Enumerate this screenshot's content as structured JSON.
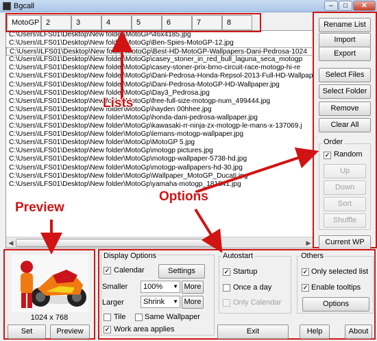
{
  "window": {
    "title": "Bgcall",
    "close_glyph": "✕",
    "min_glyph": "–",
    "max_glyph": "□"
  },
  "tabs": [
    {
      "label": "MotoGP"
    },
    {
      "label": "2"
    },
    {
      "label": "3"
    },
    {
      "label": "4"
    },
    {
      "label": "5"
    },
    {
      "label": "6"
    },
    {
      "label": "7"
    },
    {
      "label": "8"
    }
  ],
  "files": [
    "C:\\Users\\ILFS01\\Desktop\\New folder\\MotoGP\\46x4185.jpg",
    "C:\\Users\\ILFS01\\Desktop\\New folder\\MotoGp\\Ben-Spies-MotoGP-12.jpg",
    "C:\\Users\\ILFS01\\Desktop\\New folder\\MotoGp\\Best-HD-MotoGP-Wallpapers-Dani-Pedrosa-1024",
    "C:\\Users\\ILFS01\\Desktop\\New folder\\MotoGp\\casey_stoner_in_red_bull_laguna_seca_motogp",
    "C:\\Users\\ILFS01\\Desktop\\New folder\\MotoGp\\casey-stoner-prix-brno-circuit-race-motogp-hi-re",
    "C:\\Users\\ILFS01\\Desktop\\New folder\\MotoGp\\Dani-Pedrosa-Honda-Repsol-2013-Full-HD-Wallpap",
    "C:\\Users\\ILFS01\\Desktop\\New folder\\MotoGp\\Dani-Pedrosa-MotoGP-HD-Wallpaper.jpg",
    "C:\\Users\\ILFS01\\Desktop\\New folder\\MotoGp\\Day3_Pedrosa.jpg",
    "C:\\Users\\ILFS01\\Desktop\\New folder\\MotoGp\\free-full-size-motogp-num_499444.jpg",
    "C:\\Users\\ILFS01\\Desktop\\New folder\\MotoGp\\hayden 00hhee.jpg",
    "C:\\Users\\ILFS01\\Desktop\\New folder\\MotoGp\\honda-dani-pedrosa-wallpaper.jpg",
    "C:\\Users\\ILFS01\\Desktop\\New folder\\MotoGp\\kawasaki-rr-ninja-zx-motogp-le-mans-x-137069.j",
    "C:\\Users\\ILFS01\\Desktop\\New folder\\MotoGp\\lemans-motogp-wallpaper.jpg",
    "C:\\Users\\ILFS01\\Desktop\\New folder\\MotoGp\\MotoGP 5.jpg",
    "C:\\Users\\ILFS01\\Desktop\\New folder\\MotoGp\\motogp pictures.jpg",
    "C:\\Users\\ILFS01\\Desktop\\New folder\\MotoGp\\motogp-wallpaper-5738-hd.jpg",
    "C:\\Users\\ILFS01\\Desktop\\New folder\\MotoGp\\motogp-wallpapers-hd-30.jpg",
    "C:\\Users\\ILFS01\\Desktop\\New folder\\MotoGp\\Wallpaper_MotoGP_Ducati.jpg",
    "C:\\Users\\ILFS01\\Desktop\\New folder\\MotoGp\\yamaha-motogp_181841.jpg"
  ],
  "side_buttons": {
    "rename_list": "Rename List",
    "import": "Import",
    "export": "Export",
    "select_files": "Select Files",
    "select_folder": "Select Folder",
    "remove": "Remove",
    "clear_all": "Clear All",
    "order_label": "Order",
    "random": "Random",
    "up": "Up",
    "down": "Down",
    "sort": "Sort",
    "shuffle": "Shuffle",
    "current_wp": "Current WP"
  },
  "preview": {
    "resolution": "1024 x 768",
    "set": "Set",
    "preview": "Preview"
  },
  "display_options": {
    "heading": "Display Options",
    "calendar": "Calendar",
    "settings": "Settings",
    "smaller": "Smaller",
    "smaller_value": "100%",
    "larger": "Larger",
    "larger_value": "Shrink",
    "more": "More",
    "tile": "Tile",
    "same_wallpaper": "Same Wallpaper",
    "work_area": "Work area applies"
  },
  "autostart": {
    "heading": "Autostart",
    "startup": "Startup",
    "once_a_day": "Once a day",
    "only_calendar": "Only Calendar"
  },
  "others": {
    "heading": "Others",
    "only_selected": "Only selected list",
    "tooltips": "Enable tooltips",
    "options": "Options"
  },
  "footer": {
    "exit": "Exit",
    "help": "Help",
    "about": "About"
  },
  "annotations": {
    "lists": "Lists",
    "options": "Options",
    "preview": "Preview"
  },
  "colors": {
    "annotation": "#d01414"
  }
}
